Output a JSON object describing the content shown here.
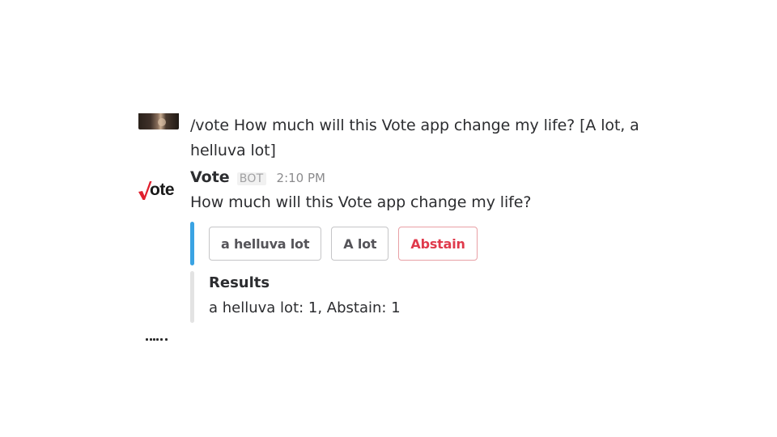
{
  "user_message": {
    "text": "/vote How much will this Vote app change my life? [A lot, a helluva lot]"
  },
  "bot_logo": {
    "icon": "vote-logo-icon",
    "text": "ote",
    "check_color": "#e0202e"
  },
  "bot_message": {
    "name": "Vote",
    "badge": "BOT",
    "time": "2:10 PM",
    "question": "How much will this Vote app change my life?"
  },
  "buttons": [
    {
      "label": "a helluva lot",
      "style": "default"
    },
    {
      "label": "A lot",
      "style": "default"
    },
    {
      "label": "Abstain",
      "style": "danger"
    }
  ],
  "results": {
    "title": "Results",
    "text": "a helluva lot: 1, Abstain: 1"
  },
  "colors": {
    "accent_bar": "#3aa3e3",
    "danger": "#e03a4c",
    "results_bar": "#e3e3e3"
  }
}
